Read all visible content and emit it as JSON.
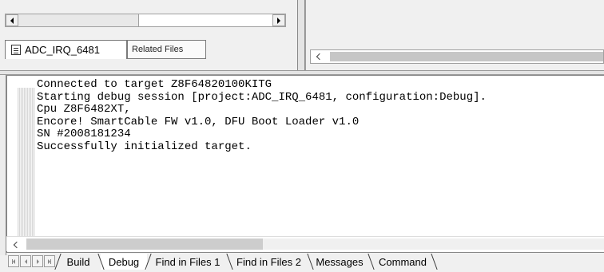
{
  "project_pane": {
    "tabs": [
      {
        "label": "ADC_IRQ_6481",
        "active": true,
        "icon": "document-icon"
      },
      {
        "label": "Related Files",
        "active": false
      }
    ]
  },
  "output": {
    "lines": [
      "Connected to target Z8F64820100KITG",
      "Starting debug session [project:ADC_IRQ_6481, configuration:Debug].",
      "Cpu Z8F6482XT,",
      "Encore! SmartCable FW v1.0, DFU Boot Loader v1.0",
      "SN #2008181234",
      "Successfully initialized target."
    ]
  },
  "bottom_tabs": [
    {
      "label": "Build",
      "active": false
    },
    {
      "label": "Debug",
      "active": true
    },
    {
      "label": "Find in Files 1",
      "active": false
    },
    {
      "label": "Find in Files 2",
      "active": false
    },
    {
      "label": "Messages",
      "active": false
    },
    {
      "label": "Command",
      "active": false
    }
  ]
}
